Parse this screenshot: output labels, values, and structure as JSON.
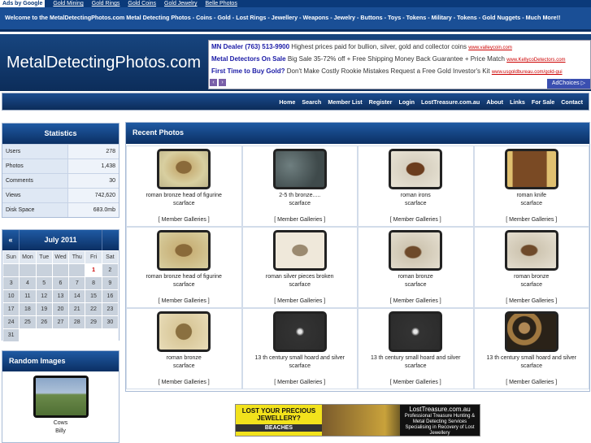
{
  "adbar": {
    "label": "Ads by Google",
    "links": [
      "Gold Mining",
      "Gold Rings",
      "Gold Coins",
      "Gold Jewelry",
      "Belle Photos"
    ]
  },
  "welcome": "Welcome to the MetalDetectingPhotos.com Metal Detecting Photos - Coins - Gold - Lost Rings - Jewellery - Weapons - Jewelry - Buttons - Toys - Tokens - Military - Tokens - Gold Nuggets - Much More!!",
  "site_title": "MetalDetectingPhotos.com",
  "ads": [
    {
      "headline": "MN Dealer (763) 513-9900",
      "text": "Highest prices paid for bullion, silver, gold and collector coins",
      "url": "www.valleycoin.com"
    },
    {
      "headline": "Metal Detectors On Sale",
      "text": "Big Sale 35-72% off + Free Shipping Money Back Guarantee + Price Match",
      "url": "www.KellycoDetectors.com"
    },
    {
      "headline": "First Time to Buy Gold?",
      "text": "Don't Make Costly Rookie Mistakes Request a Free Gold Investor's Kit",
      "url": "www.usgoldbureau.com/gold-gui"
    }
  ],
  "adchoices": "AdChoices ▷",
  "ad_prev": "‹",
  "ad_next": "›",
  "nav": [
    "Home",
    "Search",
    "Member List",
    "Register",
    "Login",
    "LostTreasure.com.au",
    "About",
    "Links",
    "For Sale",
    "Contact"
  ],
  "stats": {
    "title": "Statistics",
    "rows": [
      {
        "label": "Users",
        "value": "278"
      },
      {
        "label": "Photos",
        "value": "1,438"
      },
      {
        "label": "Comments",
        "value": "30"
      },
      {
        "label": "Views",
        "value": "742,620"
      },
      {
        "label": "Disk Space",
        "value": "683.0mb"
      }
    ]
  },
  "calendar": {
    "prev": "«",
    "month": "July 2011",
    "day_names": [
      "Sun",
      "Mon",
      "Tue",
      "Wed",
      "Thu",
      "Fri",
      "Sat"
    ],
    "days": [
      "",
      "",
      "",
      "",
      "",
      "1",
      "2",
      "3",
      "4",
      "5",
      "6",
      "7",
      "8",
      "9",
      "10",
      "11",
      "12",
      "13",
      "14",
      "15",
      "16",
      "17",
      "18",
      "19",
      "20",
      "21",
      "22",
      "23",
      "24",
      "25",
      "26",
      "27",
      "28",
      "29",
      "30",
      "31"
    ],
    "today": "1"
  },
  "random": {
    "title": "Random Images",
    "caption": "Cows",
    "owner": "Billy"
  },
  "recent": {
    "title": "Recent Photos",
    "photos": [
      {
        "title": "roman bronze head of figurine",
        "user": "scarface",
        "galleries": "[ Member Galleries ]"
      },
      {
        "title": "2-5 th bronze.....",
        "user": "scarface",
        "galleries": "[ Member Galleries ]"
      },
      {
        "title": "roman irons",
        "user": "scarface",
        "galleries": "[ Member Galleries ]"
      },
      {
        "title": "roman knife",
        "user": "scarface",
        "galleries": "[ Member Galleries ]"
      },
      {
        "title": "roman bronze head of figurine",
        "user": "scarface",
        "galleries": "[ Member Galleries ]"
      },
      {
        "title": "roman silver pieces broken",
        "user": "scarface",
        "galleries": "[ Member Galleries ]"
      },
      {
        "title": "roman bronze",
        "user": "scarface",
        "galleries": "[ Member Galleries ]"
      },
      {
        "title": "roman bronze",
        "user": "scarface",
        "galleries": "[ Member Galleries ]"
      },
      {
        "title": "roman bronze",
        "user": "scarface",
        "galleries": "[ Member Galleries ]"
      },
      {
        "title": "13 th century small hoard and silver",
        "user": "scarface",
        "galleries": "[ Member Galleries ]"
      },
      {
        "title": "13 th century small hoard and silver",
        "user": "scarface",
        "galleries": "[ Member Galleries ]"
      },
      {
        "title": "13 th century small hoard and silver",
        "user": "scarface",
        "galleries": "[ Member Galleries ]"
      }
    ]
  },
  "banner": {
    "left_text": "LOST YOUR PRECIOUS JEWELLERY?",
    "left_sub": "BEACHES",
    "right_title": "LostTreasure.com.au",
    "right_text": "Professional Treasure Hunting & Metal Detecting Services Specialising in Recovery of Lost Jewellery"
  }
}
